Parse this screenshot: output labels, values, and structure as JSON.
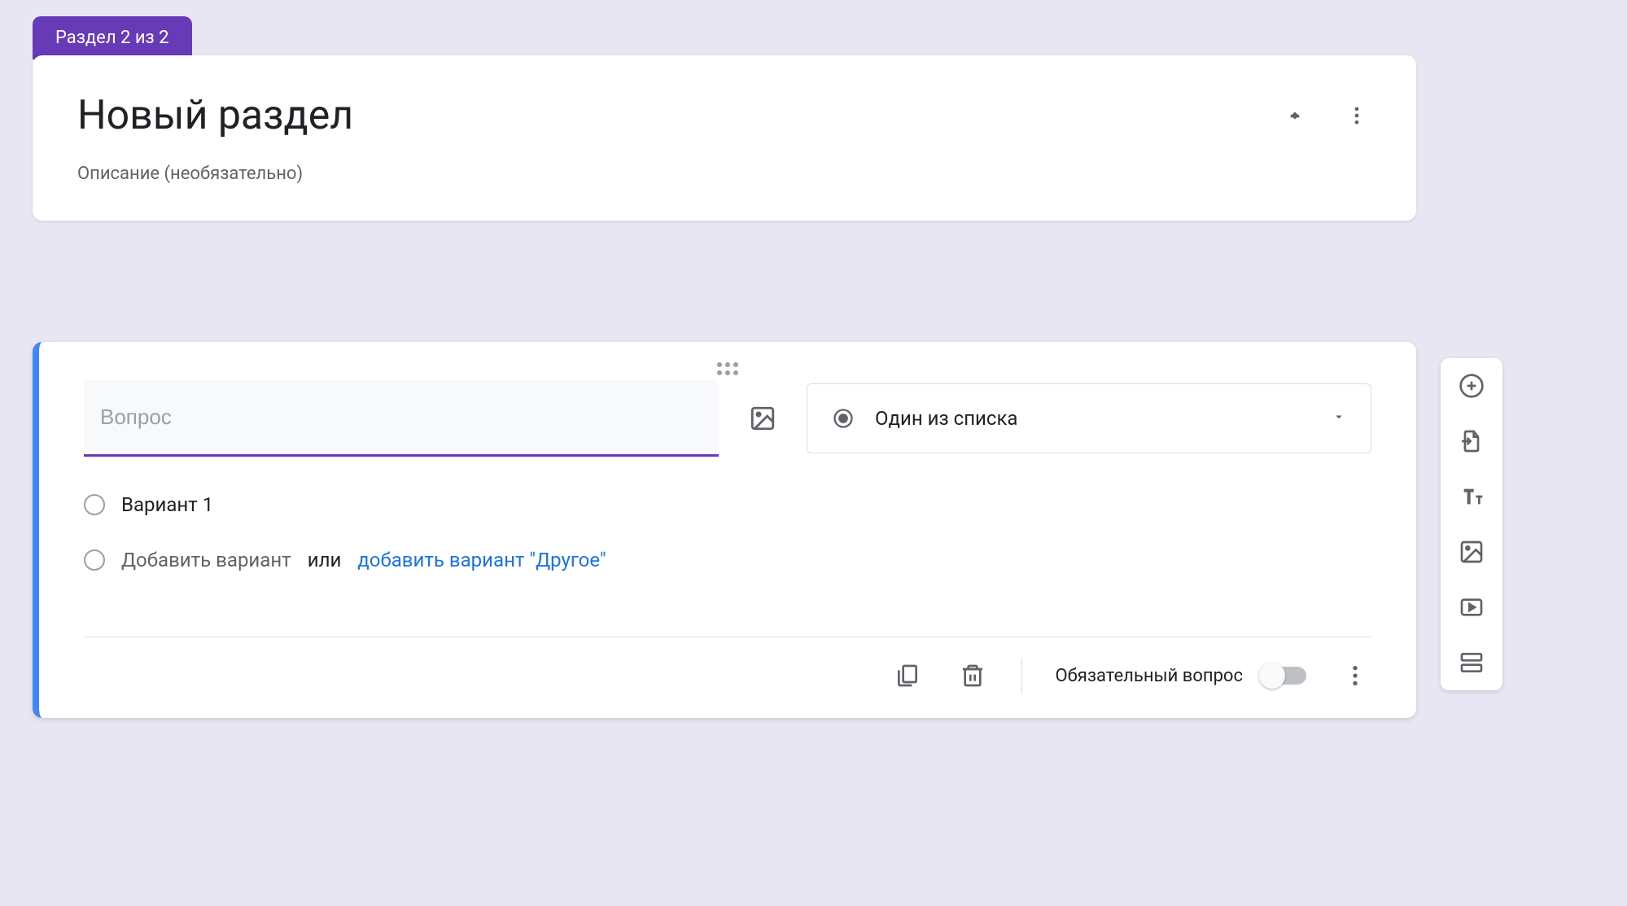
{
  "section": {
    "badge": "Раздел 2 из 2",
    "title": "Новый раздел",
    "description_placeholder": "Описание (необязательно)"
  },
  "question": {
    "placeholder": "Вопрос",
    "type_label": "Один из списка",
    "options": [
      {
        "label": "Вариант 1"
      }
    ],
    "add_option": "Добавить вариант",
    "or": "или",
    "add_other": "добавить вариант \"Другое\"",
    "required_label": "Обязательный вопрос",
    "required": false
  }
}
